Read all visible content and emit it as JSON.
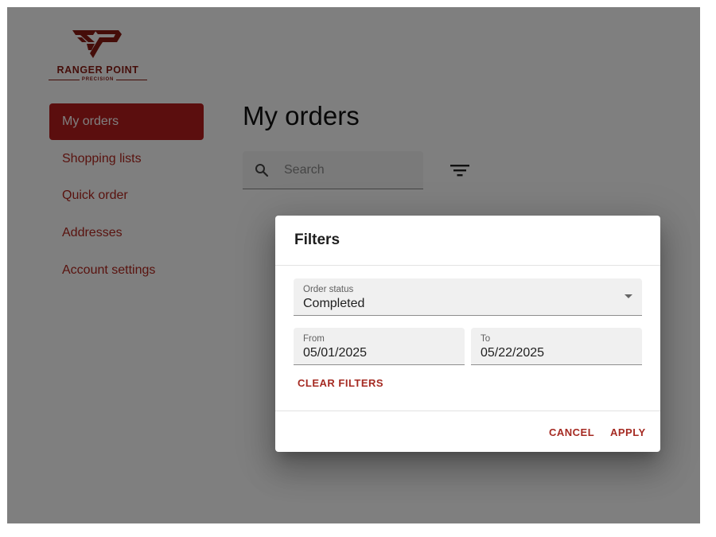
{
  "brand": {
    "name": "RANGER POINT",
    "tagline": "PRECISION",
    "color": "#8a1a12"
  },
  "sidebar": {
    "items": [
      {
        "label": "My orders",
        "active": true
      },
      {
        "label": "Shopping lists",
        "active": false
      },
      {
        "label": "Quick order",
        "active": false
      },
      {
        "label": "Addresses",
        "active": false
      },
      {
        "label": "Account settings",
        "active": false
      }
    ]
  },
  "main": {
    "title": "My orders",
    "search": {
      "placeholder": "Search",
      "icon": "search-icon"
    },
    "filter_icon": "filter-list-icon"
  },
  "dialog": {
    "title": "Filters",
    "order_status": {
      "label": "Order status",
      "value": "Completed"
    },
    "from": {
      "label": "From",
      "value": "05/01/2025"
    },
    "to": {
      "label": "To",
      "value": "05/22/2025"
    },
    "clear_label": "CLEAR FILTERS",
    "cancel_label": "CANCEL",
    "apply_label": "APPLY"
  },
  "colors": {
    "accent": "#b71c1c",
    "accent_text": "#a52a22",
    "scrim": "rgba(0,0,0,0.5)"
  }
}
